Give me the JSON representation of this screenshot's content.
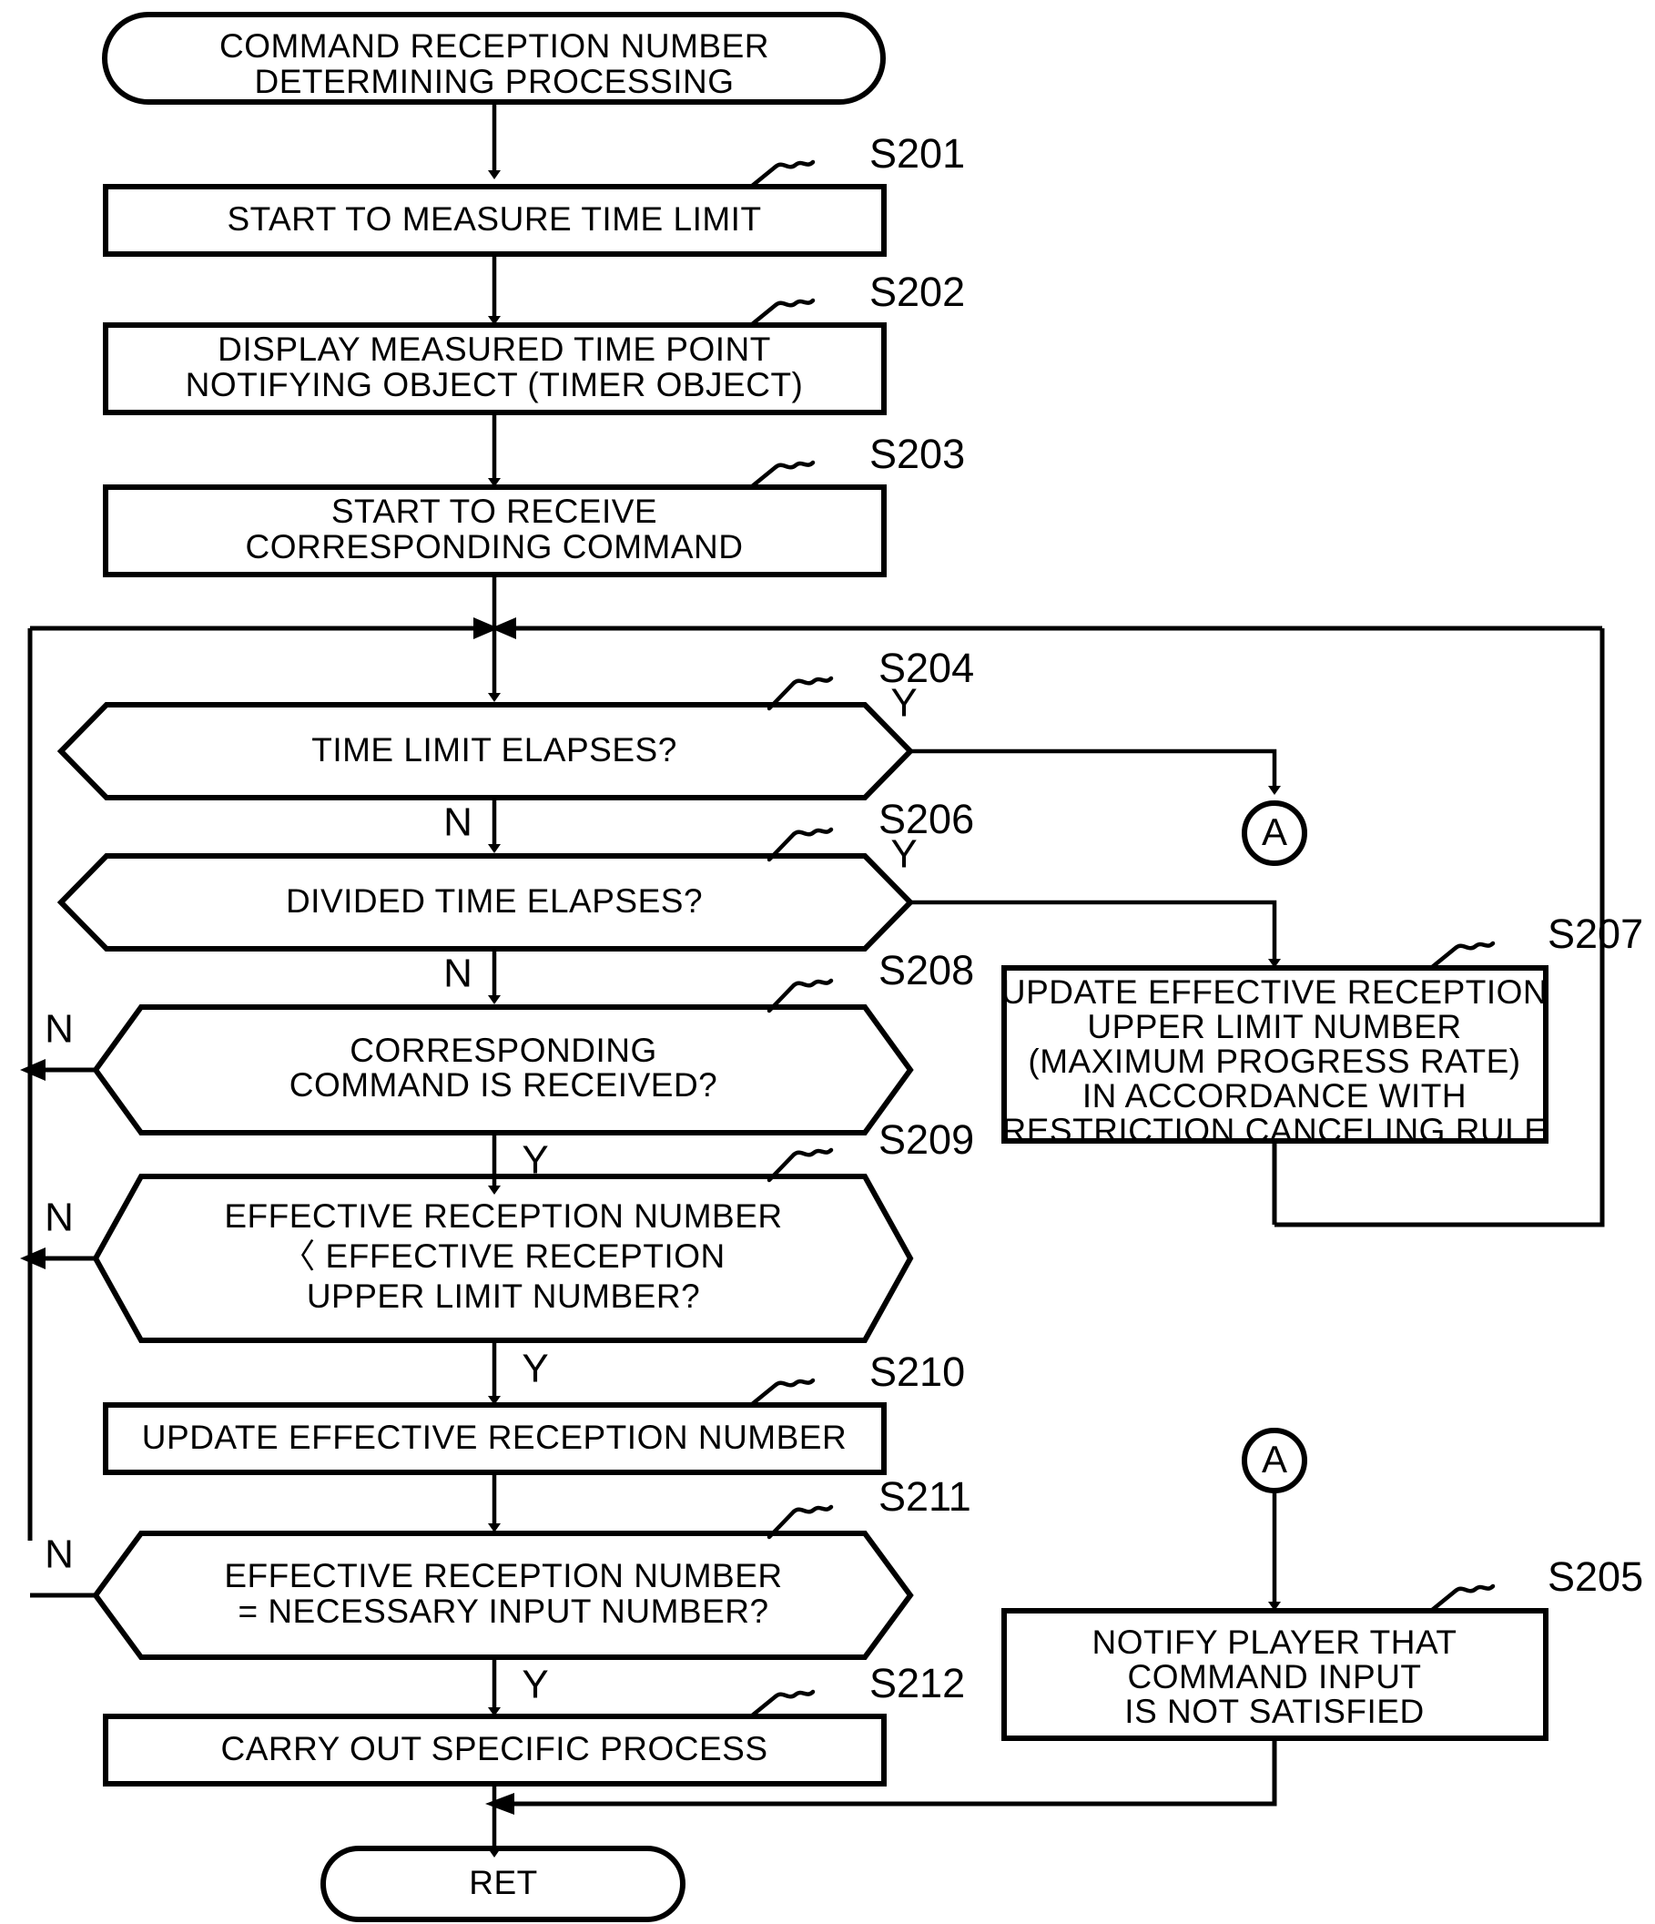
{
  "diagram": {
    "type": "flowchart",
    "title": "COMMAND RECEPTION NUMBER DETERMINING PROCESSING",
    "start_terminator": {
      "line1": "COMMAND RECEPTION NUMBER",
      "line2": "DETERMINING PROCESSING"
    },
    "end_terminator": {
      "label": "RET"
    },
    "nodes": [
      {
        "id": "S201",
        "kind": "process",
        "step_label": "S201",
        "lines": [
          "START TO MEASURE TIME LIMIT"
        ]
      },
      {
        "id": "S202",
        "kind": "process",
        "step_label": "S202",
        "lines": [
          "DISPLAY MEASURED TIME POINT",
          "NOTIFYING OBJECT (TIMER OBJECT)"
        ]
      },
      {
        "id": "S203",
        "kind": "process",
        "step_label": "S203",
        "lines": [
          "START TO RECEIVE",
          "CORRESPONDING COMMAND"
        ]
      },
      {
        "id": "S204",
        "kind": "decision",
        "step_label": "S204",
        "lines": [
          "TIME LIMIT ELAPSES?"
        ],
        "yes_label": "Y",
        "no_label": "N"
      },
      {
        "id": "S206",
        "kind": "decision",
        "step_label": "S206",
        "lines": [
          "DIVIDED TIME ELAPSES?"
        ],
        "yes_label": "Y",
        "no_label": "N"
      },
      {
        "id": "S208",
        "kind": "decision",
        "step_label": "S208",
        "lines": [
          "CORRESPONDING",
          "COMMAND IS RECEIVED?"
        ],
        "yes_label": "Y",
        "no_label": "N"
      },
      {
        "id": "S209",
        "kind": "decision",
        "step_label": "S209",
        "lines": [
          "EFFECTIVE RECEPTION NUMBER",
          "〈 EFFECTIVE RECEPTION",
          "UPPER LIMIT NUMBER?"
        ],
        "yes_label": "Y",
        "no_label": "N"
      },
      {
        "id": "S210",
        "kind": "process",
        "step_label": "S210",
        "lines": [
          "UPDATE EFFECTIVE RECEPTION NUMBER"
        ]
      },
      {
        "id": "S211",
        "kind": "decision",
        "step_label": "S211",
        "lines": [
          "EFFECTIVE RECEPTION NUMBER",
          "= NECESSARY INPUT NUMBER?"
        ],
        "yes_label": "Y",
        "no_label": "N"
      },
      {
        "id": "S212",
        "kind": "process",
        "step_label": "S212",
        "lines": [
          "CARRY OUT SPECIFIC PROCESS"
        ]
      },
      {
        "id": "S207",
        "kind": "process",
        "step_label": "S207",
        "lines": [
          "UPDATE EFFECTIVE RECEPTION",
          "UPPER LIMIT NUMBER",
          "(MAXIMUM PROGRESS RATE)",
          "IN ACCORDANCE WITH",
          "RESTRICTION CANCELING RULE"
        ]
      },
      {
        "id": "S205",
        "kind": "process",
        "step_label": "S205",
        "lines": [
          "NOTIFY PLAYER THAT",
          "COMMAND INPUT",
          "IS NOT SATISFIED"
        ]
      }
    ],
    "connectors": [
      {
        "id": "A-top",
        "label": "A"
      },
      {
        "id": "A-bottom",
        "label": "A"
      }
    ],
    "colors": {
      "stroke": "#000000",
      "fill": "#ffffff",
      "text": "#000000"
    }
  }
}
